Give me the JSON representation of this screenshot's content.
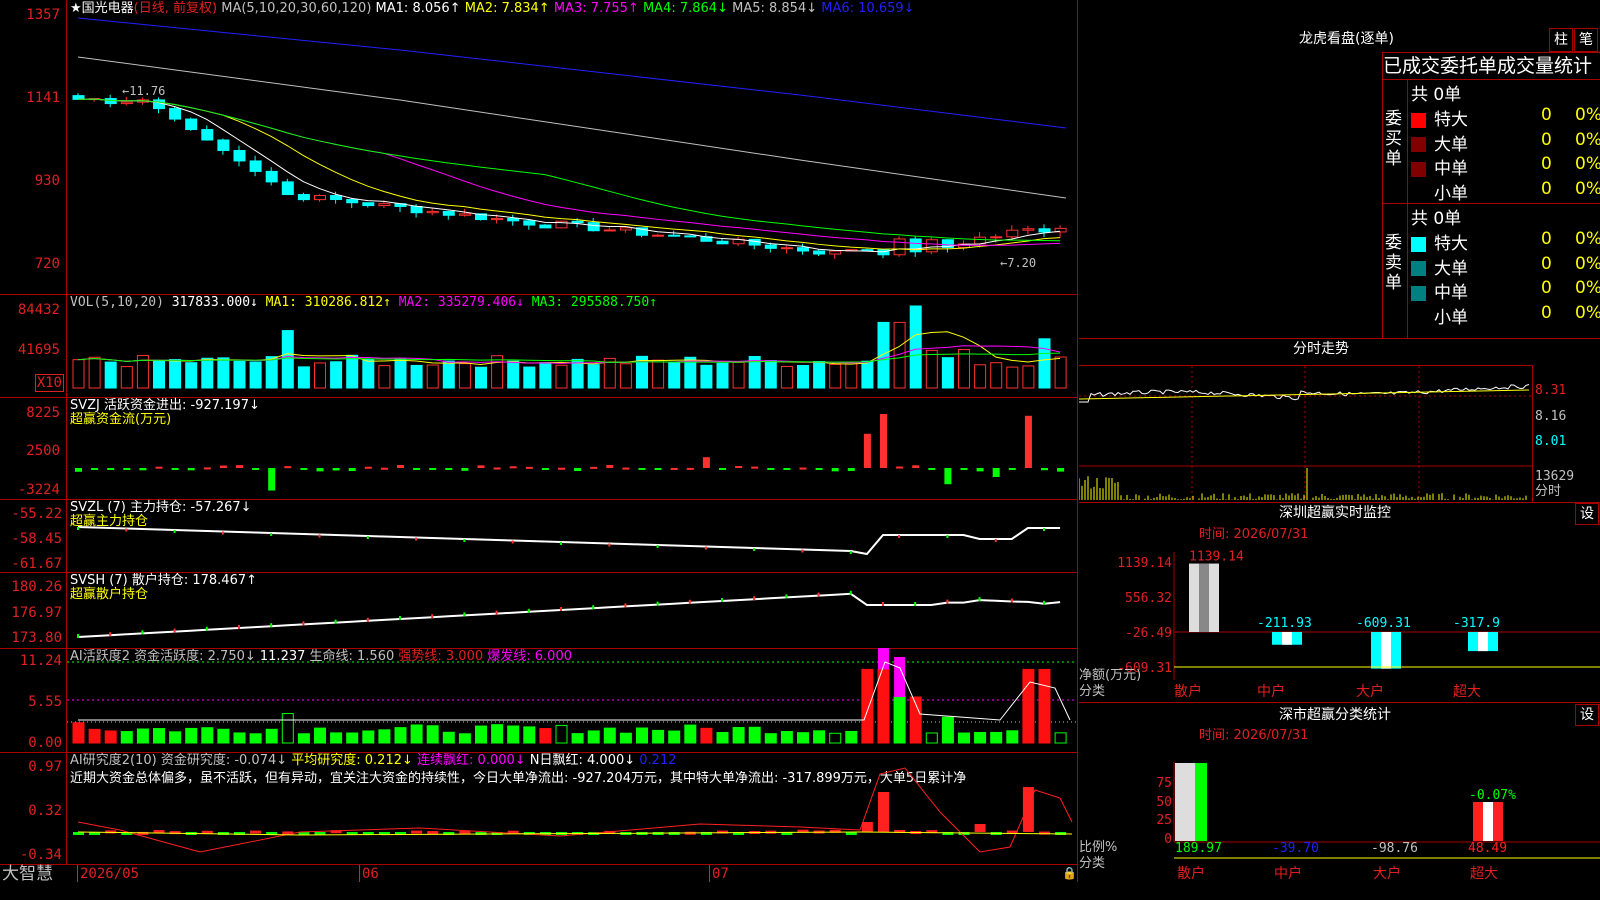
{
  "stock": {
    "star": "★",
    "name": "国光电器",
    "period": "(日线, 前复权)"
  },
  "ma_line": [
    {
      "text": "MA(5,10,20,30,60,120)",
      "color": "#c0c0c0"
    },
    {
      "text": "MA1: 8.056↑",
      "color": "#ffffff"
    },
    {
      "text": "MA2: 7.834↑",
      "color": "#ffff00"
    },
    {
      "text": "MA3: 7.755↑",
      "color": "#ff00ff"
    },
    {
      "text": "MA4: 7.864↓",
      "color": "#00ff00"
    },
    {
      "text": "MA5: 8.854↓",
      "color": "#c0c0c0"
    },
    {
      "text": "MA6: 10.659↓",
      "color": "#2020ff"
    }
  ],
  "price_axis": [
    "1357",
    "1141",
    "930",
    "720"
  ],
  "annot_high": "←11.76",
  "annot_low": "←7.20",
  "vol_line": [
    {
      "text": "VOL(5,10,20)",
      "color": "#c0c0c0"
    },
    {
      "text": "317833.000↓",
      "color": "#ffffff"
    },
    {
      "text": "MA1: 310286.812↑",
      "color": "#ffff00"
    },
    {
      "text": "MA2: 335279.406↓",
      "color": "#ff00ff"
    },
    {
      "text": "MA3: 295588.750↑",
      "color": "#00ff00"
    }
  ],
  "vol_axis": [
    "84432",
    "41695"
  ],
  "vol_unit": "X10",
  "svzj": {
    "line1": "SVZJ  活跃资金进出: -927.197↓",
    "line2": "超赢资金流(万元)",
    "axis": [
      "8225",
      "2500",
      "-3224"
    ]
  },
  "svzl": {
    "line1": "SVZL (7) 主力持仓: -57.267↓",
    "line2": "超赢主力持仓",
    "axis": [
      "-55.22",
      "-58.45",
      "-61.67"
    ]
  },
  "svsh": {
    "line1": "SVSH (7) 散户持仓: 178.467↑",
    "line2": "超赢散户持仓",
    "axis": [
      "180.26",
      "176.97",
      "173.80"
    ]
  },
  "ai1": {
    "parts": [
      {
        "text": "AI活跃度2 资金活跃度: 2.750↓",
        "color": "#c0c0c0"
      },
      {
        "text": "11.237",
        "color": "#ffffff"
      },
      {
        "text": "生命线: 1.560",
        "color": "#c0c0c0"
      },
      {
        "text": "强势线: 3.000",
        "color": "#e02020"
      },
      {
        "text": "爆发线: 6.000",
        "color": "#ff00ff"
      }
    ],
    "axis": [
      "11.24",
      "5.55",
      "0.00"
    ]
  },
  "ai2": {
    "parts": [
      {
        "text": "AI研究度2(10) 资金研究度: -0.074↓",
        "color": "#c0c0c0"
      },
      {
        "text": "平均研究度: 0.212↓",
        "color": "#ffff00"
      },
      {
        "text": "连续飘红: 0.000↓",
        "color": "#ff00ff"
      },
      {
        "text": "N日飘红: 4.000↓",
        "color": "#ffffff"
      },
      {
        "text": "0.212",
        "color": "#2020ff"
      }
    ],
    "comment": "近期大资金总体偏多，虽不活跃，但有异动，宜关注大资金的持续性，今日大单净流出: -927.204万元，其中特大单净流出: -317.899万元，大单5日累计净",
    "axis": [
      "0.97",
      "0.32",
      "-0.34"
    ]
  },
  "footer": {
    "brand": "大智慧",
    "dates": [
      "2026/05",
      "06",
      "07"
    ]
  },
  "right": {
    "lhb_title": "龙虎看盘(逐单)",
    "btn_zhu": "柱",
    "btn_bi": "笔",
    "sub_title": "已成交委托单成交量统计",
    "buy_label": "委买单",
    "sell_label": "委卖单",
    "buy_total": "共 0单",
    "sell_total": "共 0单",
    "buy_rows": [
      {
        "label": "特大",
        "count": "0",
        "pct": "0%",
        "color": "#ff0000"
      },
      {
        "label": "大单",
        "count": "0",
        "pct": "0%",
        "color": "#800000"
      },
      {
        "label": "中单",
        "count": "0",
        "pct": "0%",
        "color": "#800000"
      },
      {
        "label": "小单",
        "count": "0",
        "pct": "0%",
        "color": ""
      }
    ],
    "sell_rows": [
      {
        "label": "特大",
        "count": "0",
        "pct": "0%",
        "color": "#00ffff"
      },
      {
        "label": "大单",
        "count": "0",
        "pct": "0%",
        "color": "#008080"
      },
      {
        "label": "中单",
        "count": "0",
        "pct": "0%",
        "color": "#008080"
      },
      {
        "label": "小单",
        "count": "0",
        "pct": "0%",
        "color": ""
      }
    ],
    "fs_title": "分时走势",
    "fs_axis": [
      "8.31",
      "8.16",
      "8.01"
    ],
    "fs_vol": "13629",
    "fs_vol_unit": "分时",
    "mon_title": "深圳超赢实时监控",
    "mon_btn": "设",
    "mon_time": "时间: 2026/07/31",
    "mon_axis": [
      "1139.14",
      "556.32",
      "-26.49",
      "-609.31"
    ],
    "mon_bars": [
      {
        "name": "散户",
        "value": "1139.14"
      },
      {
        "name": "中户",
        "value": "-211.93"
      },
      {
        "name": "大户",
        "value": "-609.31"
      },
      {
        "name": "超大",
        "value": "-317.9"
      }
    ],
    "mon_ylabel": "净额(万元)",
    "mon_xlabel": "分类",
    "cls_title": "深市超赢分类统计",
    "cls_btn": "设",
    "cls_time": "时间: 2026/07/31",
    "cls_axis": [
      "75",
      "50",
      "25",
      "0"
    ],
    "cls_top_label": "-0.07%",
    "cls_bars": [
      {
        "name": "散户",
        "value": "189.97",
        "color": "#00ff00"
      },
      {
        "name": "中户",
        "value": "-39.70",
        "color": "#2020ff"
      },
      {
        "name": "大户",
        "value": "-98.76",
        "color": "#c0c0c0"
      },
      {
        "name": "超大",
        "value": "48.49",
        "color": "#ff2020"
      }
    ],
    "cls_ylabel": "比例%",
    "cls_xlabel": "分类"
  }
}
